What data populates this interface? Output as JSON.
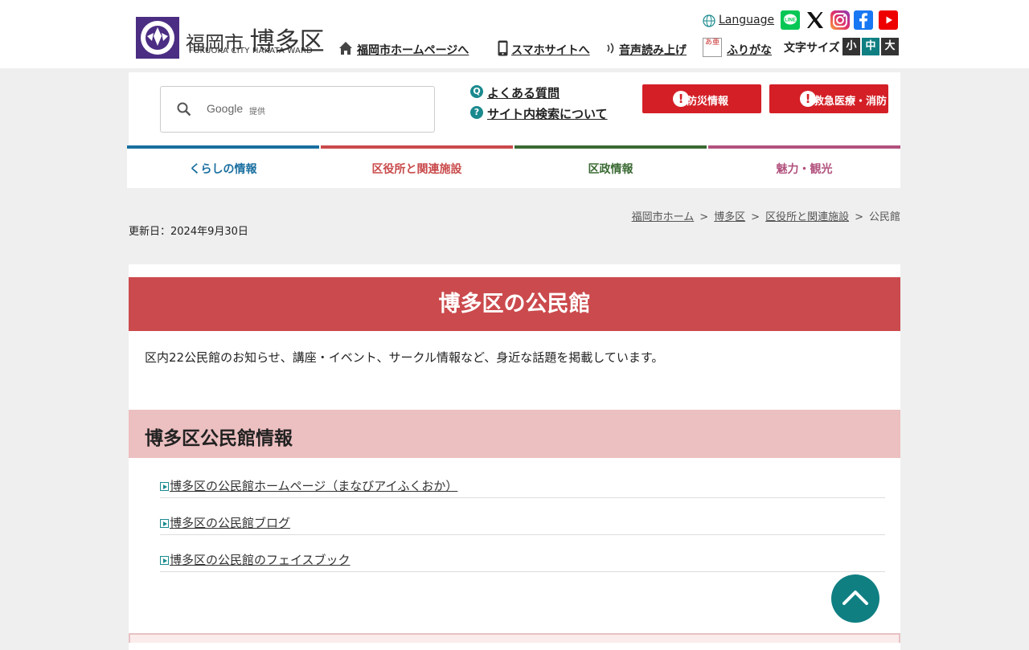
{
  "header": {
    "logo_city": "福岡市",
    "logo_ward": "博多区",
    "logo_en": "FUKUOKA CITY HAKATA WARD",
    "language_label": "Language",
    "links": {
      "home": "福岡市ホームページへ",
      "smartphone": "スマホサイトへ",
      "read_aloud": "音声読み上げ",
      "furigana": "ふりがな"
    },
    "furigana_icon_text": "あ亜",
    "font_size_label": "文字サイズ",
    "font_sizes": [
      "小",
      "中",
      "大"
    ]
  },
  "search": {
    "provider_text": "Google",
    "provider_suffix": "提供"
  },
  "quick_links": {
    "faq": "よくある質問",
    "faq_icon": "Q",
    "search_help": "サイト内検索について",
    "search_help_icon": "?"
  },
  "emergency": {
    "disaster": "防災情報",
    "medical": "救急医療・消防"
  },
  "nav": {
    "tabs": [
      {
        "label": "くらしの情報",
        "color": "#1a6fa0"
      },
      {
        "label": "区役所と関連施設",
        "color": "#c94a4b"
      },
      {
        "label": "区政情報",
        "color": "#3a6a33"
      },
      {
        "label": "魅力・観光",
        "color": "#b2527e"
      }
    ]
  },
  "breadcrumb": {
    "items": [
      "福岡市ホーム",
      "博多区",
      "区役所と関連施設"
    ],
    "current": "公民館",
    "separator": ">"
  },
  "updated": "更新日：2024年9月30日",
  "page": {
    "title": "博多区の公民館",
    "intro": "区内22公民館のお知らせ、講座・イベント、サークル情報など、身近な話題を掲載しています。",
    "section_title": "博多区公民館情報",
    "links": [
      "博多区の公民館ホームページ（まなびアイふくおか）",
      "博多区の公民館ブログ",
      "博多区の公民館のフェイスブック"
    ]
  },
  "colors": {
    "title_band": "#cb4a4d",
    "section_band": "#ecbfc0",
    "accent_teal": "#0f7f82",
    "emergency_red": "#d41f26",
    "logo_purple": "#4b2d83"
  },
  "icons": {
    "home": "home-icon",
    "phone": "smartphone-icon",
    "audio": "sound-icon",
    "globe": "globe-icon",
    "search": "search-icon",
    "pagetop": "chevron-up-icon"
  }
}
